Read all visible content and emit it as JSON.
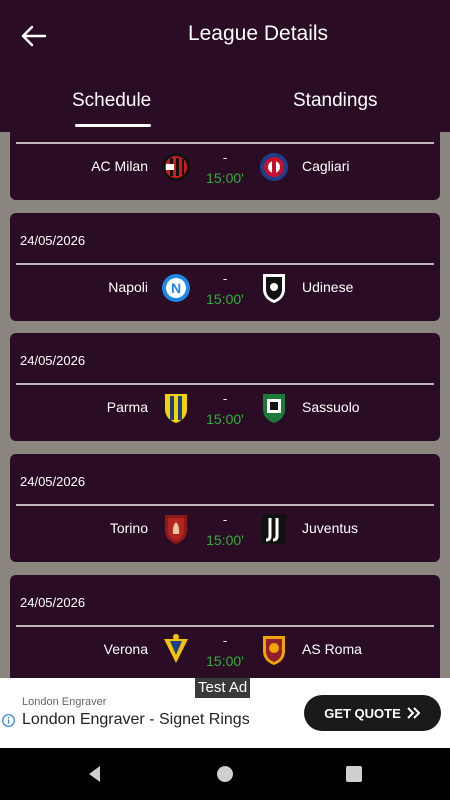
{
  "header": {
    "title": "League Details"
  },
  "tabs": [
    {
      "label": "Schedule",
      "active": true
    },
    {
      "label": "Standings",
      "active": false
    }
  ],
  "matches": [
    {
      "date": "",
      "home": "AC Milan",
      "away": "Cagliari",
      "separator": "-",
      "time": "15:00'",
      "home_logo": "ac-milan-logo",
      "away_logo": "cagliari-logo"
    },
    {
      "date": "24/05/2026",
      "home": "Napoli",
      "away": "Udinese",
      "separator": "-",
      "time": "15:00'",
      "home_logo": "napoli-logo",
      "away_logo": "udinese-logo"
    },
    {
      "date": "24/05/2026",
      "home": "Parma",
      "away": "Sassuolo",
      "separator": "-",
      "time": "15:00'",
      "home_logo": "parma-logo",
      "away_logo": "sassuolo-logo"
    },
    {
      "date": "24/05/2026",
      "home": "Torino",
      "away": "Juventus",
      "separator": "-",
      "time": "15:00'",
      "home_logo": "torino-logo",
      "away_logo": "juventus-logo"
    },
    {
      "date": "24/05/2026",
      "home": "Verona",
      "away": "AS Roma",
      "separator": "-",
      "time": "15:00'",
      "home_logo": "verona-logo",
      "away_logo": "as-roma-logo"
    }
  ],
  "ad": {
    "tag": "Test Ad",
    "advertiser": "London Engraver",
    "headline": "London Engraver - Signet Rings",
    "cta": "GET QUOTE"
  },
  "colors": {
    "app_background": "#2a0c24",
    "list_background": "#8b8680",
    "time_green": "#2fae3a"
  }
}
